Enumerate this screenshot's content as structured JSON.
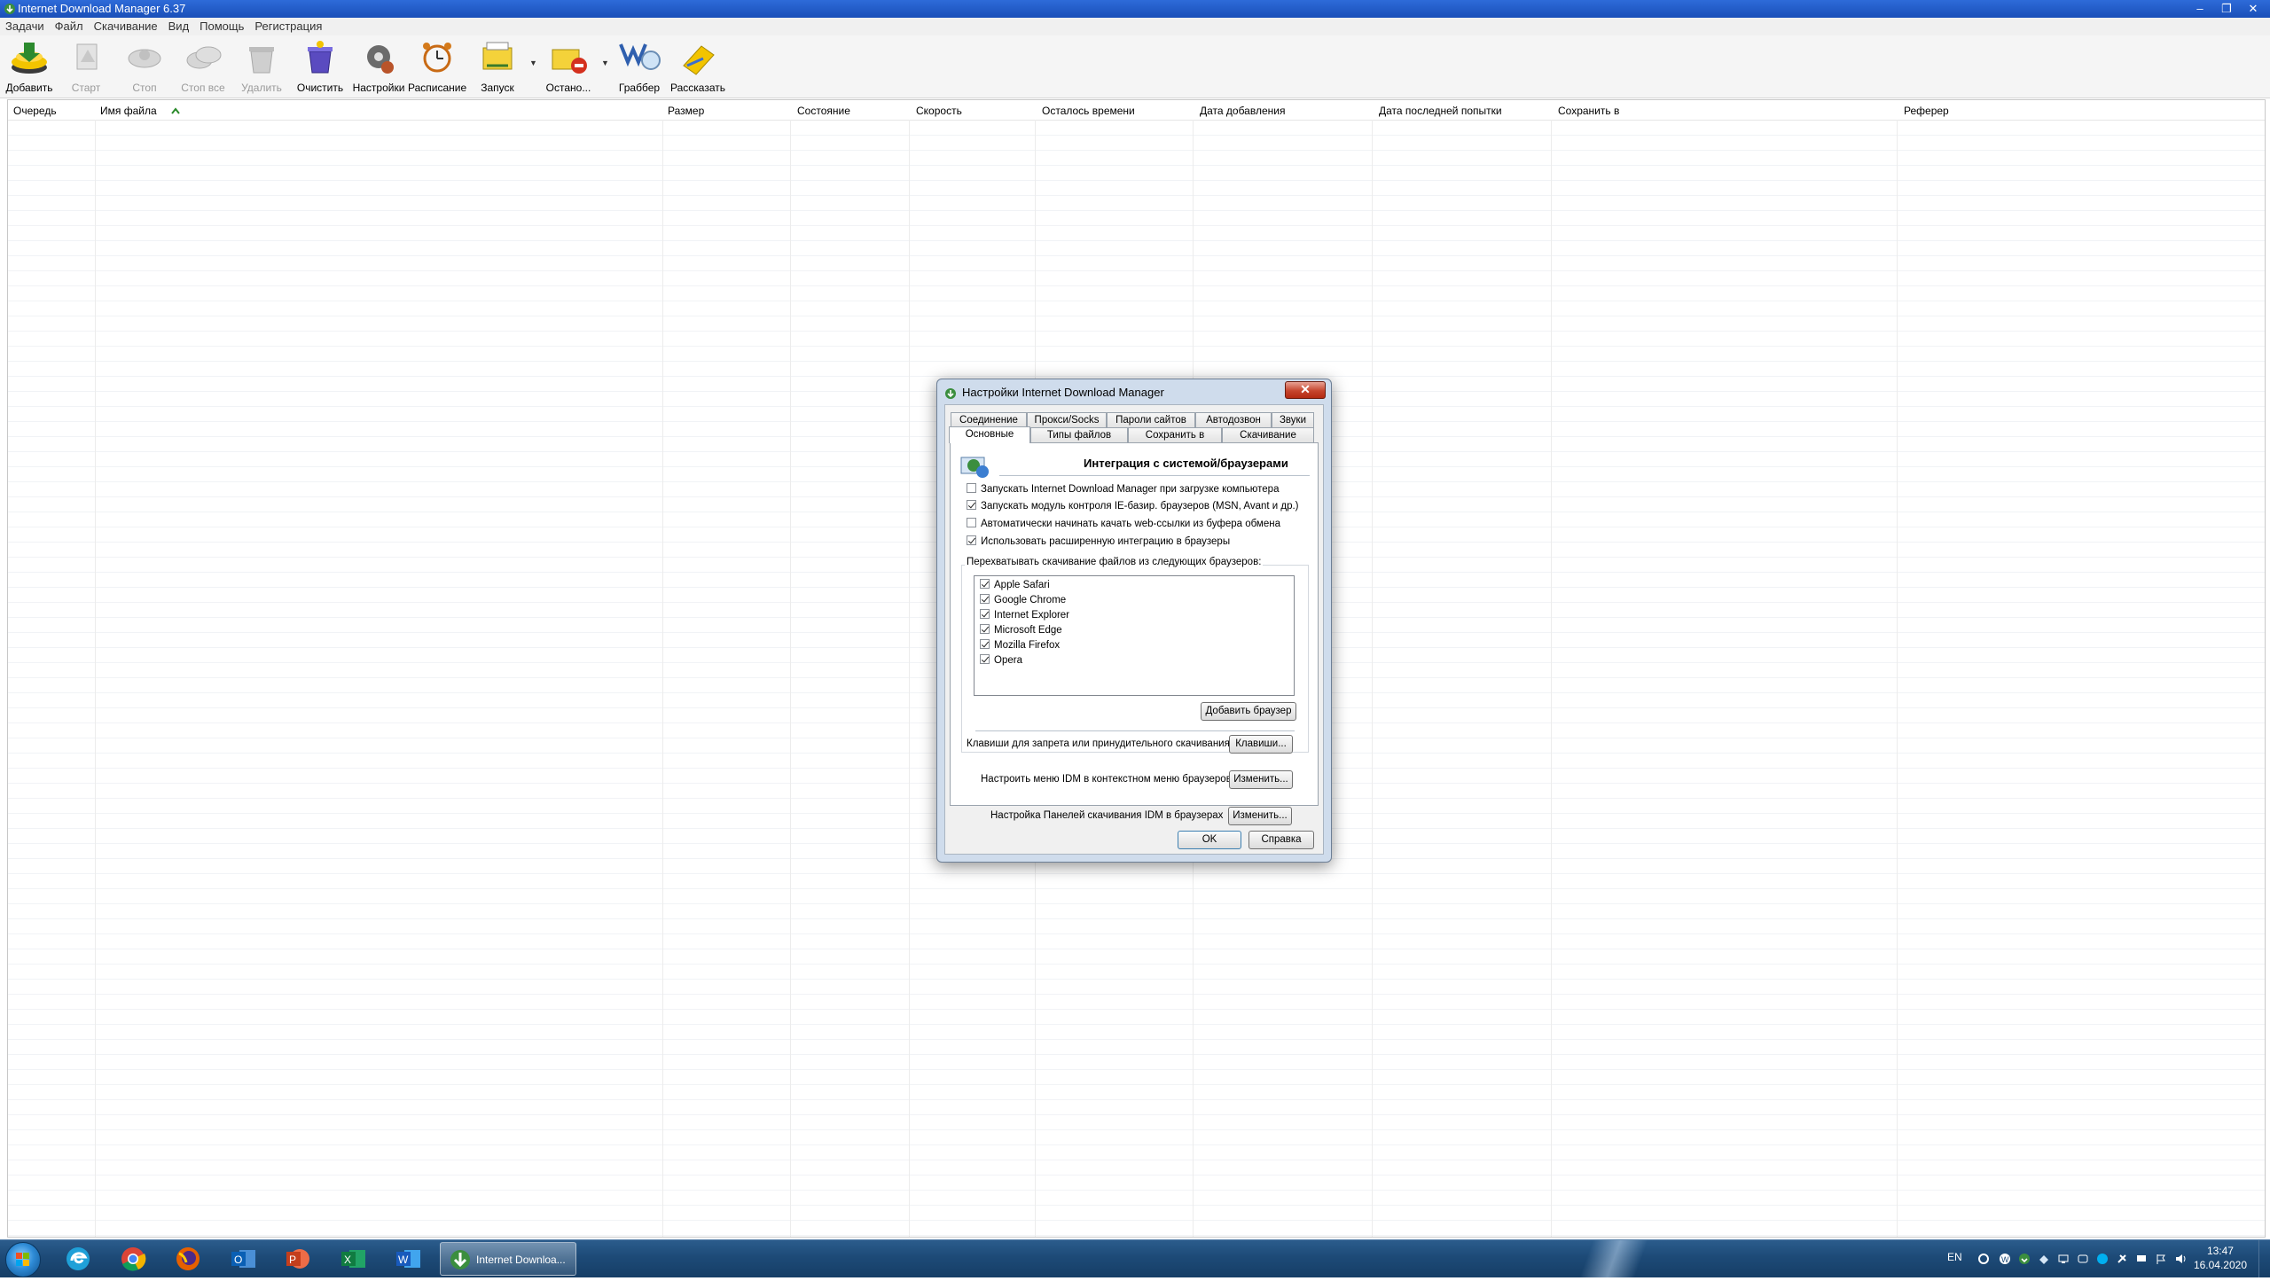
{
  "window": {
    "title": "Internet Download Manager 6.37",
    "buttons": [
      "‒",
      "❐",
      "✕"
    ]
  },
  "menu": [
    "Задачи",
    "Файл",
    "Скачивание",
    "Вид",
    "Помощь",
    "Регистрация"
  ],
  "toolbar": {
    "add": "Добавить",
    "start": "Старт",
    "stop": "Стоп",
    "stop_all": "Стоп все",
    "delete": "Удалить",
    "clear": "Очистить",
    "settings": "Настройки",
    "schedule": "Расписание",
    "launch": "Запуск",
    "stop_queue": "Остано...",
    "grabber": "Граббер",
    "tell": "Рассказать"
  },
  "columns": {
    "queue": "Очередь",
    "filename": "Имя файла",
    "size": "Размер",
    "status": "Состояние",
    "speed": "Скорость",
    "time_left": "Осталось времени",
    "date_added": "Дата добавления",
    "last_try": "Дата последней попытки",
    "save_to": "Сохранить в",
    "referer": "Реферер"
  },
  "dialog": {
    "title": "Настройки Internet Download Manager",
    "close": "✕",
    "tabs_top": [
      "Соединение",
      "Прокси/Socks",
      "Пароли сайтов",
      "Автодозвон",
      "Звуки"
    ],
    "tabs_bottom": [
      "Основные",
      "Типы файлов",
      "Сохранить в",
      "Скачивание"
    ],
    "active_tab": "Основные",
    "heading": "Интеграция с системой/браузерами",
    "options": [
      {
        "label": "Запускать Internet Download Manager при загрузке компьютера",
        "checked": false
      },
      {
        "label": "Запускать модуль контроля IE-базир. браузеров (MSN, Avant и др.)",
        "checked": true
      },
      {
        "label": "Автоматически начинать качать web-ссылки из буфера обмена",
        "checked": false
      },
      {
        "label": "Использовать расширенную интеграцию в браузеры",
        "checked": true
      }
    ],
    "browsers_label": "Перехватывать скачивание файлов из следующих браузеров:",
    "browsers": [
      {
        "name": "Apple Safari",
        "checked": true
      },
      {
        "name": "Google Chrome",
        "checked": true
      },
      {
        "name": "Internet Explorer",
        "checked": true
      },
      {
        "name": "Microsoft Edge",
        "checked": true
      },
      {
        "name": "Mozilla Firefox",
        "checked": true
      },
      {
        "name": "Opera",
        "checked": true
      }
    ],
    "add_browser": "Добавить браузер",
    "keys_label": "Клавиши для запрета или принудительного скачивания",
    "keys_button": "Клавиши...",
    "context_menu_label": "Настроить меню IDM в контекстном меню браузеров",
    "context_menu_button": "Изменить...",
    "panel_label": "Настройка Панелей скачивания IDM в браузерах",
    "panel_button": "Изменить...",
    "ok": "OK",
    "help": "Справка"
  },
  "taskbar": {
    "active_app": "Internet Downloa...",
    "language": "EN",
    "time": "13:47",
    "date": "16.04.2020"
  }
}
